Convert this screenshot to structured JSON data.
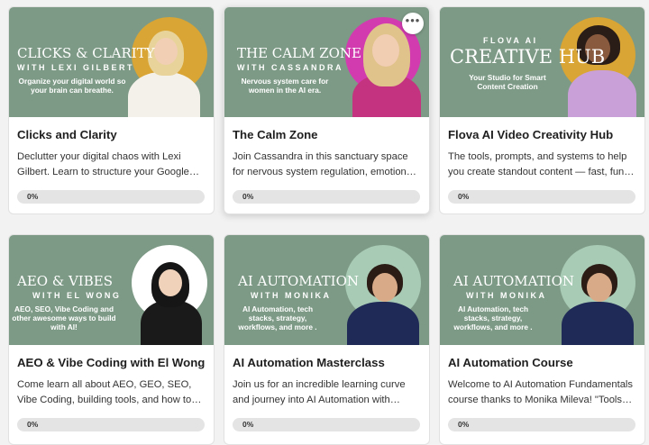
{
  "courses": [
    {
      "title": "Clicks and Clarity",
      "description": "Declutter your digital chaos with Lexi Gilbert. Learn to structure your Google Workspace, streamline your digital life.",
      "progress": "0%",
      "banner": {
        "line1": "CLICKS & CLARITY",
        "line2": "WITH LEXI GILBERT",
        "tagline": "Organize your digital world so your brain can breathe."
      }
    },
    {
      "title": "The Calm Zone",
      "description": "Join Cassandra in this sanctuary space for nervous system regulation, emotional balance and calm.",
      "progress": "0%",
      "more_label": "•••",
      "banner": {
        "line1": "THE CALM ZONE",
        "line2": "WITH CASSANDRA",
        "tagline": "Nervous system care for women in the AI era."
      }
    },
    {
      "title": "Flova AI Video Creativity Hub",
      "description": "The tools, prompts, and systems to help you create standout content — fast, fun, and AI-powered.",
      "progress": "0%",
      "banner": {
        "line1": "FLOVA AI",
        "line2": "CREATIVE HUB",
        "tagline": "Your Studio for Smart Content Creation"
      }
    },
    {
      "title": "AEO & Vibe Coding with El Wong",
      "description": "Come learn all about AEO, GEO, SEO, Vibe Coding, building tools, and how to optimise your site for AI.",
      "progress": "0%",
      "banner": {
        "line1": "AEO & VIBES",
        "line2": "WITH EL WONG",
        "tagline": "AEO, SEO, Vibe Coding and other awesome ways to build with AI!"
      }
    },
    {
      "title": "AI Automation Masterclass",
      "description": "Join us for an incredible learning curve and journey into AI Automation with Monika Mileva.",
      "progress": "0%",
      "banner": {
        "line1": "AI AUTOMATION",
        "line2": "WITH MONIKA",
        "tagline": "AI Automation, tech stacks, strategy, workflows, and more ."
      }
    },
    {
      "title": "AI Automation Course",
      "description": "Welcome to AI Automation Fundamentals course thanks to Monika Mileva! \"Tools and systems.\"",
      "progress": "0%",
      "banner": {
        "line1": "AI AUTOMATION",
        "line2": "WITH MONIKA",
        "tagline": "AI Automation, tech stacks, strategy, workflows, and more ."
      }
    }
  ],
  "colors": {
    "banner_green": "#7d9a86",
    "circle_gold": "#d9a534",
    "circle_magenta": "#d23bb0",
    "circle_sage": "#a8cbb5",
    "progress_track": "#e4e4e4"
  }
}
